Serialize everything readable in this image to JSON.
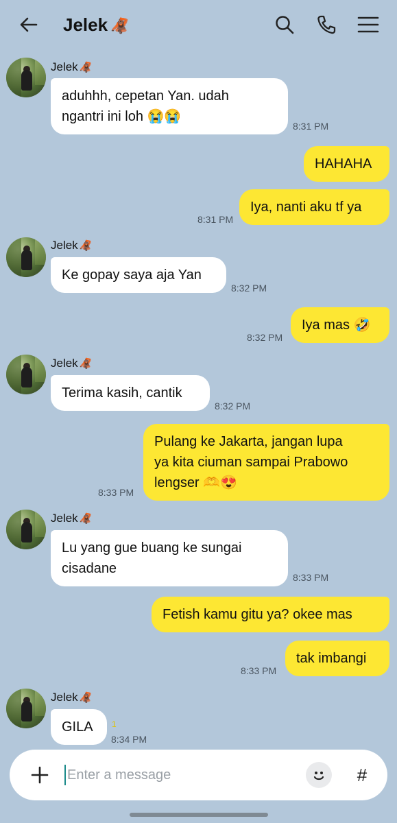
{
  "header": {
    "title": "Jelek",
    "title_emoji": "🦧"
  },
  "contact": {
    "name": "Jelek",
    "name_emoji": "🦧"
  },
  "messages": [
    {
      "dir": "in",
      "lines": [
        "aduhhh, cepetan Yan. udah",
        "ngantri ini loh 😭😭"
      ],
      "time": "8:31 PM"
    },
    {
      "dir": "out",
      "lines": [
        "HAHAHA"
      ],
      "time": ""
    },
    {
      "dir": "out",
      "lines": [
        "Iya, nanti aku tf ya"
      ],
      "time": "8:31 PM"
    },
    {
      "dir": "in",
      "lines": [
        "Ke gopay saya aja Yan"
      ],
      "time": "8:32 PM"
    },
    {
      "dir": "out",
      "lines": [
        "Iya mas 🤣"
      ],
      "time": "8:32 PM"
    },
    {
      "dir": "in",
      "lines": [
        "Terima kasih, cantik"
      ],
      "time": "8:32 PM"
    },
    {
      "dir": "out",
      "lines": [
        "Pulang ke Jakarta, jangan lupa",
        "ya kita ciuman sampai Prabowo",
        "lengser 🫶😍"
      ],
      "time": "8:33 PM"
    },
    {
      "dir": "in",
      "lines": [
        "Lu yang gue buang ke sungai",
        "cisadane"
      ],
      "time": "8:33 PM"
    },
    {
      "dir": "out",
      "lines": [
        "Fetish kamu gitu ya? okee mas"
      ],
      "time": ""
    },
    {
      "dir": "out",
      "lines": [
        "tak imbangi"
      ],
      "time": "8:33 PM"
    },
    {
      "dir": "in",
      "lines": [
        "GILA"
      ],
      "time": "8:34 PM",
      "unread": "1"
    }
  ],
  "composer": {
    "placeholder": "Enter a message",
    "hash_label": "#"
  },
  "colors": {
    "background": "#b3c7da",
    "outgoing": "#fde733",
    "incoming": "#ffffff"
  }
}
